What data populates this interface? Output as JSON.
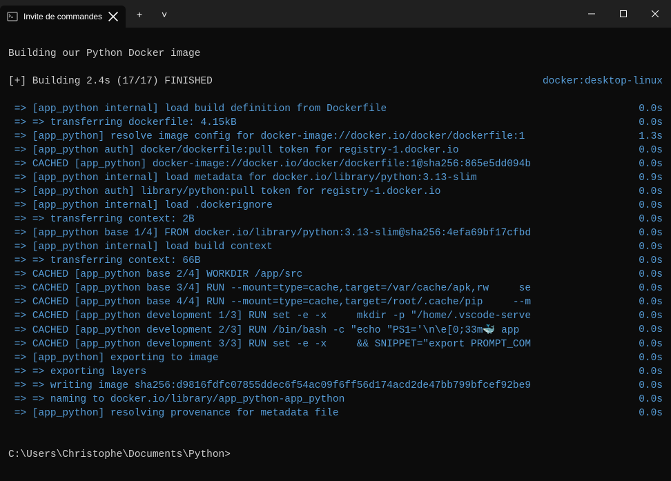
{
  "titlebar": {
    "tab_title": "Invite de commandes",
    "tab_icon_label": "cmd-icon",
    "new_tab": "+",
    "dropdown": "˅"
  },
  "header_line": "Building our Python Docker image",
  "build_summary_left": "[+] Building 2.4s (17/17) FINISHED",
  "build_summary_right": "docker:desktop-linux",
  "lines": [
    {
      "a": "=>",
      "m": "[app_python internal] load build definition from Dockerfile",
      "t": "0.0s"
    },
    {
      "a": "=>",
      "m": "=> transferring dockerfile: 4.15kB",
      "t": "0.0s"
    },
    {
      "a": "=>",
      "m": "[app_python] resolve image config for docker-image://docker.io/docker/dockerfile:1",
      "t": "1.3s"
    },
    {
      "a": "=>",
      "m": "[app_python auth] docker/dockerfile:pull token for registry-1.docker.io",
      "t": "0.0s"
    },
    {
      "a": "=>",
      "m": "CACHED [app_python] docker-image://docker.io/docker/dockerfile:1@sha256:865e5dd094b",
      "t": "0.0s"
    },
    {
      "a": "=>",
      "m": "[app_python internal] load metadata for docker.io/library/python:3.13-slim",
      "t": "0.9s"
    },
    {
      "a": "=>",
      "m": "[app_python auth] library/python:pull token for registry-1.docker.io",
      "t": "0.0s"
    },
    {
      "a": "=>",
      "m": "[app_python internal] load .dockerignore",
      "t": "0.0s"
    },
    {
      "a": "=>",
      "m": "=> transferring context: 2B",
      "t": "0.0s"
    },
    {
      "a": "=>",
      "m": "[app_python base 1/4] FROM docker.io/library/python:3.13-slim@sha256:4efa69bf17cfbd",
      "t": "0.0s"
    },
    {
      "a": "=>",
      "m": "[app_python internal] load build context",
      "t": "0.0s"
    },
    {
      "a": "=>",
      "m": "=> transferring context: 66B",
      "t": "0.0s"
    },
    {
      "a": "=>",
      "m": "CACHED [app_python base 2/4] WORKDIR /app/src",
      "t": "0.0s"
    },
    {
      "a": "=>",
      "m": "CACHED [app_python base 3/4] RUN --mount=type=cache,target=/var/cache/apk,rw     se",
      "t": "0.0s"
    },
    {
      "a": "=>",
      "m": "CACHED [app_python base 4/4] RUN --mount=type=cache,target=/root/.cache/pip     --m",
      "t": "0.0s"
    },
    {
      "a": "=>",
      "m": "CACHED [app_python development 1/3] RUN set -e -x     mkdir -p \"/home/.vscode-serve",
      "t": "0.0s"
    },
    {
      "a": "=>",
      "m": "CACHED [app_python development 2/3] RUN /bin/bash -c \"echo \"PS1='\\n\\e[0;33m🐳 app",
      "t": "  0.0s"
    },
    {
      "a": "=>",
      "m": "CACHED [app_python development 3/3] RUN set -e -x     && SNIPPET=\"export PROMPT_COM",
      "t": "0.0s"
    },
    {
      "a": "=>",
      "m": "[app_python] exporting to image",
      "t": "0.0s"
    },
    {
      "a": "=>",
      "m": "=> exporting layers",
      "t": "0.0s"
    },
    {
      "a": "=>",
      "m": "=> writing image sha256:d9816fdfc07855ddec6f54ac09f6ff56d174acd2de47bb799bfcef92be9",
      "t": "0.0s"
    },
    {
      "a": "=>",
      "m": "=> naming to docker.io/library/app_python-app_python",
      "t": "0.0s"
    },
    {
      "a": "=>",
      "m": "[app_python] resolving provenance for metadata file",
      "t": "0.0s"
    }
  ],
  "prompt": "C:\\Users\\Christophe\\Documents\\Python>"
}
